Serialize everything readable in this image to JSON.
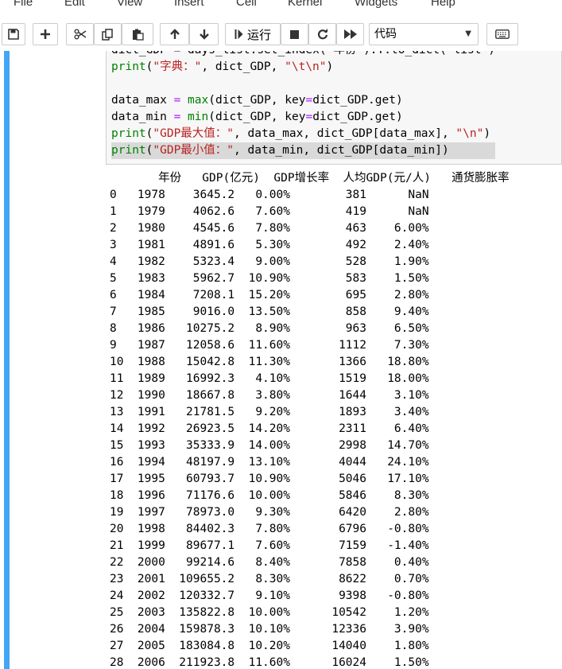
{
  "menu": [
    "File",
    "Edit",
    "View",
    "Insert",
    "Cell",
    "Kernel",
    "Widgets",
    "Help"
  ],
  "toolbar": {
    "icons": [
      "save-icon",
      "plus-icon",
      "scissors-icon",
      "copy-icon",
      "paste-icon",
      "arrow-up-icon",
      "arrow-down-icon",
      "run-icon",
      "stop-icon",
      "restart-icon",
      "fast-forward-icon",
      "keyboard-icon"
    ],
    "run_label": "运行",
    "cell_type": "代码"
  },
  "code_lines": [
    {
      "segs": [
        [
          "n",
          "dict_GDP = days_list.set_index('年份').T.to_dict('list')"
        ]
      ]
    },
    {
      "segs": [
        [
          "kw",
          "print"
        ],
        [
          "n",
          "("
        ],
        [
          "str",
          "\"字典：\""
        ],
        [
          "n",
          ", dict_GDP, "
        ],
        [
          "str",
          "\"\\t\\n\""
        ],
        [
          "n",
          ")"
        ]
      ]
    },
    {
      "segs": [
        [
          "n",
          ""
        ]
      ]
    },
    {
      "segs": [
        [
          "n",
          "data_max "
        ],
        [
          "op",
          "="
        ],
        [
          "n",
          " "
        ],
        [
          "kw",
          "max"
        ],
        [
          "n",
          "(dict_GDP, key"
        ],
        [
          "op",
          "="
        ],
        [
          "n",
          "dict_GDP.get)"
        ]
      ]
    },
    {
      "segs": [
        [
          "n",
          "data_min "
        ],
        [
          "op",
          "="
        ],
        [
          "n",
          " "
        ],
        [
          "kw",
          "min"
        ],
        [
          "n",
          "(dict_GDP, key"
        ],
        [
          "op",
          "="
        ],
        [
          "n",
          "dict_GDP.get)"
        ]
      ]
    },
    {
      "segs": [
        [
          "kw",
          "print"
        ],
        [
          "n",
          "("
        ],
        [
          "str",
          "\"GDP最大值：\""
        ],
        [
          "n",
          ", data_max, dict_GDP[data_max], "
        ],
        [
          "str",
          "\"\\n\""
        ],
        [
          "n",
          ")"
        ]
      ]
    },
    {
      "segs": [
        [
          "kw",
          "print"
        ],
        [
          "n",
          "("
        ],
        [
          "str",
          "\"GDP最小值：\""
        ],
        [
          "n",
          ", data_min, dict_GDP[data_min])"
        ]
      ],
      "selected": true
    }
  ],
  "output_lines": [
    "       年份   GDP(亿元)  GDP增长率  人均GDP(元/人)   通货膨胀率",
    "0   1978    3645.2   0.00%        381      NaN",
    "1   1979    4062.6   7.60%        419      NaN",
    "2   1980    4545.6   7.80%        463    6.00%",
    "3   1981    4891.6   5.30%        492    2.40%",
    "4   1982    5323.4   9.00%        528    1.90%",
    "5   1983    5962.7  10.90%        583    1.50%",
    "6   1984    7208.1  15.20%        695    2.80%",
    "7   1985    9016.0  13.50%        858    9.40%",
    "8   1986   10275.2   8.90%        963    6.50%",
    "9   1987   12058.6  11.60%       1112    7.30%",
    "10  1988   15042.8  11.30%       1366   18.80%",
    "11  1989   16992.3   4.10%       1519   18.00%",
    "12  1990   18667.8   3.80%       1644    3.10%",
    "13  1991   21781.5   9.20%       1893    3.40%",
    "14  1992   26923.5  14.20%       2311    6.40%",
    "15  1993   35333.9  14.00%       2998   14.70%",
    "16  1994   48197.9  13.10%       4044   24.10%",
    "17  1995   60793.7  10.90%       5046   17.10%",
    "18  1996   71176.6  10.00%       5846    8.30%",
    "19  1997   78973.0   9.30%       6420    2.80%",
    "20  1998   84402.3   7.80%       6796   -0.80%",
    "21  1999   89677.1   7.60%       7159   -1.40%",
    "22  2000   99214.6   8.40%       7858    0.40%",
    "23  2001  109655.2   8.30%       8622    0.70%",
    "24  2002  120332.7   9.10%       9398   -0.80%",
    "25  2003  135822.8  10.00%      10542    1.20%",
    "26  2004  159878.3  10.10%      12336    3.90%",
    "27  2005  183084.8  10.20%      14040    1.80%",
    "28  2006  211923.8  11.60%      16024    1.50%"
  ],
  "colors": {
    "cell_selected_bar": "#42a5f5",
    "keyword": "#008000",
    "string": "#ba2121",
    "operator": "#aa22ff"
  }
}
